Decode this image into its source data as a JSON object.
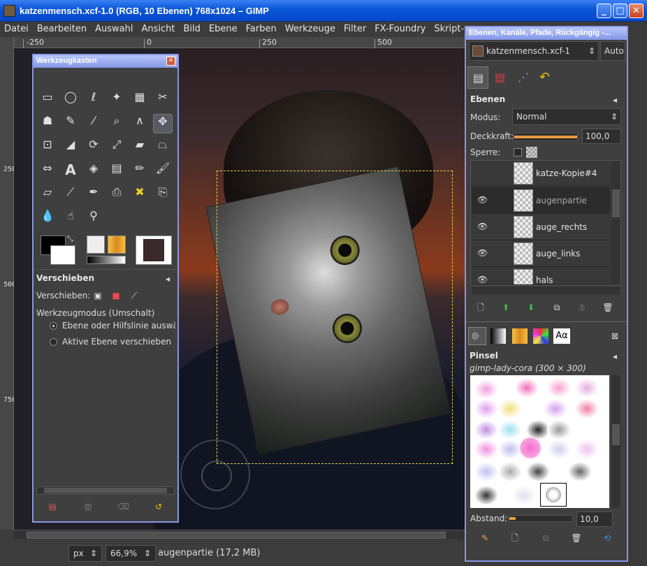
{
  "window": {
    "title": "katzenmensch.xcf-1.0 (RGB, 10 Ebenen) 768x1024 – GIMP",
    "min": "_",
    "max": "□",
    "close": "✕"
  },
  "menu": [
    "Datei",
    "Bearbeiten",
    "Auswahl",
    "Ansicht",
    "Bild",
    "Ebene",
    "Farben",
    "Werkzeuge",
    "Filter",
    "FX-Foundry",
    "Skript-Fu"
  ],
  "ruler": {
    "top": [
      "-250",
      "0",
      "250",
      "500"
    ],
    "left": [
      "250",
      "500",
      "750"
    ]
  },
  "toolbox": {
    "title": "Werkzeugkasten",
    "tool_options_title": "Verschieben",
    "move_label": "Verschieben:",
    "mode_title": "Werkzeugmodus (Umschalt)",
    "options": [
      "Ebene oder Hilfslinie auswählen",
      "Aktive Ebene verschieben"
    ]
  },
  "status": {
    "unit": "px",
    "zoom": "66,9%",
    "info": "augenpartie (17,2 MB)"
  },
  "dock": {
    "title": "Ebenen, Kanäle, Pfade, Rückgängig -...",
    "image_select": "katzenmensch.xcf-1",
    "auto": "Auto",
    "layers_title": "Ebenen",
    "mode_label": "Modus:",
    "mode_value": "Normal",
    "opacity_label": "Deckkraft:",
    "opacity_value": "100,0",
    "lock_label": "Sperre:",
    "layers": [
      {
        "name": "katze-Kopie#4",
        "visible": false
      },
      {
        "name": "augenpartie",
        "visible": true
      },
      {
        "name": "auge_rechts",
        "visible": true
      },
      {
        "name": "auge_links",
        "visible": true
      },
      {
        "name": "hals",
        "visible": true
      }
    ],
    "brushes_title": "Pinsel",
    "brush_name": "gimp-lady-cora (300 × 300)",
    "spacing_label": "Abstand:",
    "spacing_value": "10,0",
    "tab_text": "Aα"
  },
  "colors": {
    "accent": "#8a96e6",
    "selection": "#e6d34a"
  }
}
